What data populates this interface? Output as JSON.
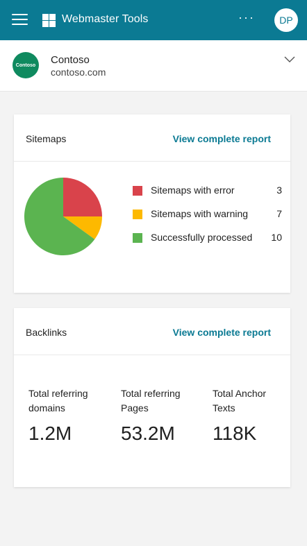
{
  "appbar": {
    "title": "Webmaster Tools",
    "menu_icon": "hamburger-icon",
    "more_label": "···",
    "avatar_initials": "DP",
    "color": "#0b7a93"
  },
  "site": {
    "logo_text": "Contoso",
    "name": "Contoso",
    "url": "contoso.com",
    "logo_color": "#0f8a5f"
  },
  "sitemaps": {
    "title": "Sitemaps",
    "link": "View complete report",
    "legend": [
      {
        "label": "Sitemaps with error",
        "count": "3",
        "color": "#d9434b"
      },
      {
        "label": "Sitemaps with warning",
        "count": "7",
        "color": "#fdb900"
      },
      {
        "label": "Successfully processed",
        "count": "10",
        "color": "#5bb450"
      }
    ]
  },
  "chart_data": {
    "type": "pie",
    "categories": [
      "Sitemaps with error",
      "Sitemaps with warning",
      "Successfully processed"
    ],
    "values": [
      5,
      2,
      13
    ],
    "colors": [
      "#d9434b",
      "#fdb900",
      "#5bb450"
    ]
  },
  "backlinks": {
    "title": "Backlinks",
    "link": "View complete report",
    "metrics": [
      {
        "label_line1": "Total referring",
        "label_line2": "domains",
        "value": "1.2M"
      },
      {
        "label_line1": "Total referring",
        "label_line2": "Pages",
        "value": "53.2M"
      },
      {
        "label_line1": "Total Anchor",
        "label_line2": "Texts",
        "value": "118K"
      }
    ]
  }
}
